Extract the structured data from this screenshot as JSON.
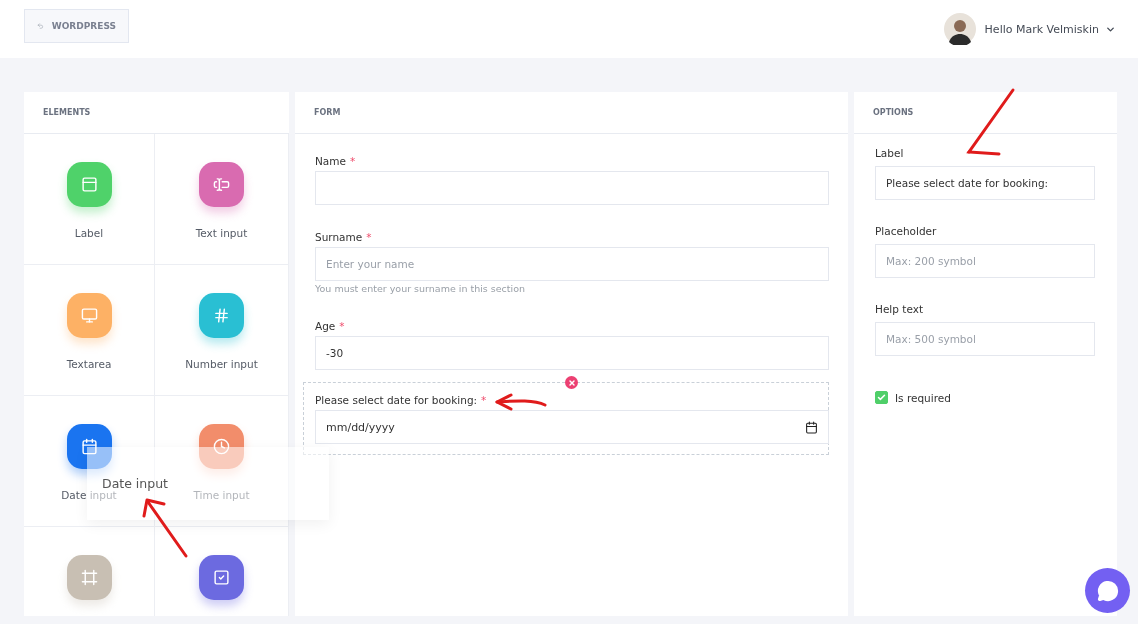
{
  "header": {
    "back_button": "WORDPRESS",
    "user": {
      "greeting": "Hello Mark Velmiskin"
    }
  },
  "elements": {
    "title": "ELEMENTS",
    "items": [
      {
        "kind": "label",
        "label": "Label",
        "color": "#4fd26a"
      },
      {
        "kind": "text",
        "label": "Text input",
        "color": "#d96bb0"
      },
      {
        "kind": "textarea",
        "label": "Textarea",
        "color": "#fdb165"
      },
      {
        "kind": "number",
        "label": "Number input",
        "color": "#29bfd3"
      },
      {
        "kind": "date",
        "label": "Date input",
        "color": "#1a74f0"
      },
      {
        "kind": "time",
        "label": "Time input",
        "color": "#f28d6b"
      },
      {
        "kind": "frame",
        "color": "#c8bfb3"
      },
      {
        "kind": "checkbox",
        "color": "#6c6ae0"
      }
    ]
  },
  "drag_ghost": {
    "label": "Date input"
  },
  "form": {
    "title": "FORM",
    "fields": [
      {
        "kind": "text",
        "label": "Name",
        "required_mark": "*",
        "selected": false
      },
      {
        "kind": "text",
        "label": "Surname",
        "required_mark": "*",
        "placeholder": "Enter your name",
        "help": "You must enter your surname in this section",
        "selected": false
      },
      {
        "kind": "text",
        "label": "Age",
        "required_mark": "*",
        "value": "-30",
        "selected": false
      },
      {
        "kind": "date",
        "label": "Please select date for booking:",
        "required_mark": "*",
        "value": "mm/dd/yyyy",
        "selected": true
      }
    ]
  },
  "options": {
    "title": "OPTIONS",
    "fields": [
      {
        "label": "Label",
        "value": "Please select date for booking:"
      },
      {
        "label": "Placeholder",
        "placeholder": "Max: 200 symbol"
      },
      {
        "label": "Help text",
        "placeholder": "Max: 500 symbol"
      }
    ],
    "required_checkbox": {
      "label": "Is required",
      "checked": true
    }
  }
}
